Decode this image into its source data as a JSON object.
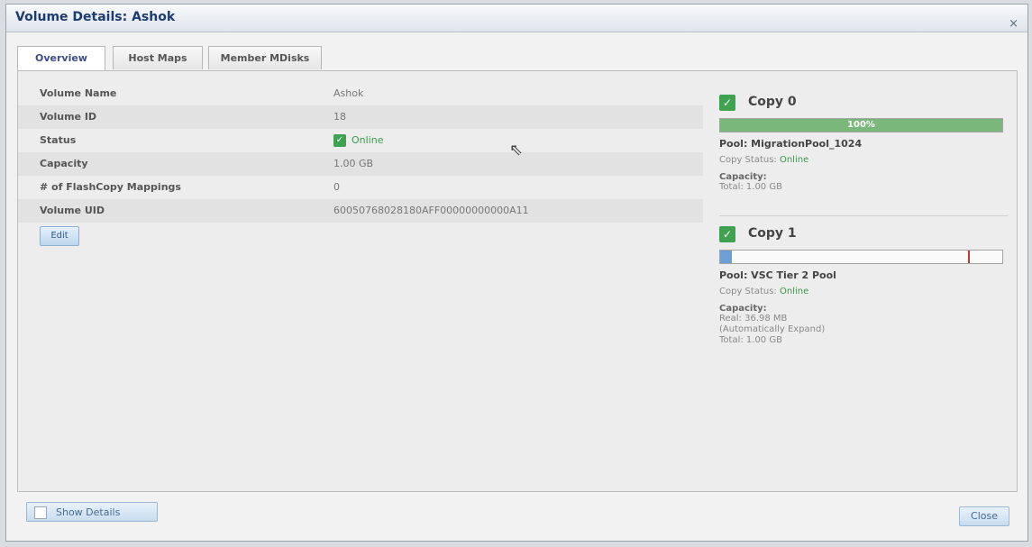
{
  "window": {
    "title": "Volume Details: Ashok",
    "close_glyph": "×"
  },
  "tabs": [
    {
      "label": "Overview",
      "active": true
    },
    {
      "label": "Host Maps",
      "active": false
    },
    {
      "label": "Member MDisks",
      "active": false
    }
  ],
  "properties": [
    {
      "label": "Volume Name",
      "value": "Ashok"
    },
    {
      "label": "Volume ID",
      "value": "18"
    },
    {
      "label": "Status",
      "value": "Online"
    },
    {
      "label": "Capacity",
      "value": "1.00 GB"
    },
    {
      "label": "# of FlashCopy Mappings",
      "value": "0"
    },
    {
      "label": "Volume UID",
      "value": "60050768028180AFF00000000000A11"
    }
  ],
  "edit_label": "Edit",
  "copies": [
    {
      "title": "Copy 0",
      "progress_percent": 100,
      "progress_text": "100%",
      "pool": "Pool: MigrationPool_1024",
      "copy_status_label": "Copy Status:",
      "copy_status_value": "Online",
      "capacity_label": "Capacity:",
      "capacity_lines": [
        "Total: 1.00 GB"
      ]
    },
    {
      "title": "Copy 1",
      "progress_percent": 4,
      "progress_marker_percent": 88,
      "pool": "Pool: VSC Tier 2 Pool",
      "copy_status_label": "Copy Status:",
      "copy_status_value": "Online",
      "capacity_label": "Capacity:",
      "capacity_lines": [
        "Real: 36.98 MB",
        "(Automatically Expand)",
        "Total: 1.00 GB"
      ]
    }
  ],
  "footer": {
    "show_details_label": "Show Details",
    "close_label": "Close"
  },
  "colors": {
    "online": "#3a9b4a",
    "title": "#1d3b73",
    "progress": "#79b87a"
  }
}
